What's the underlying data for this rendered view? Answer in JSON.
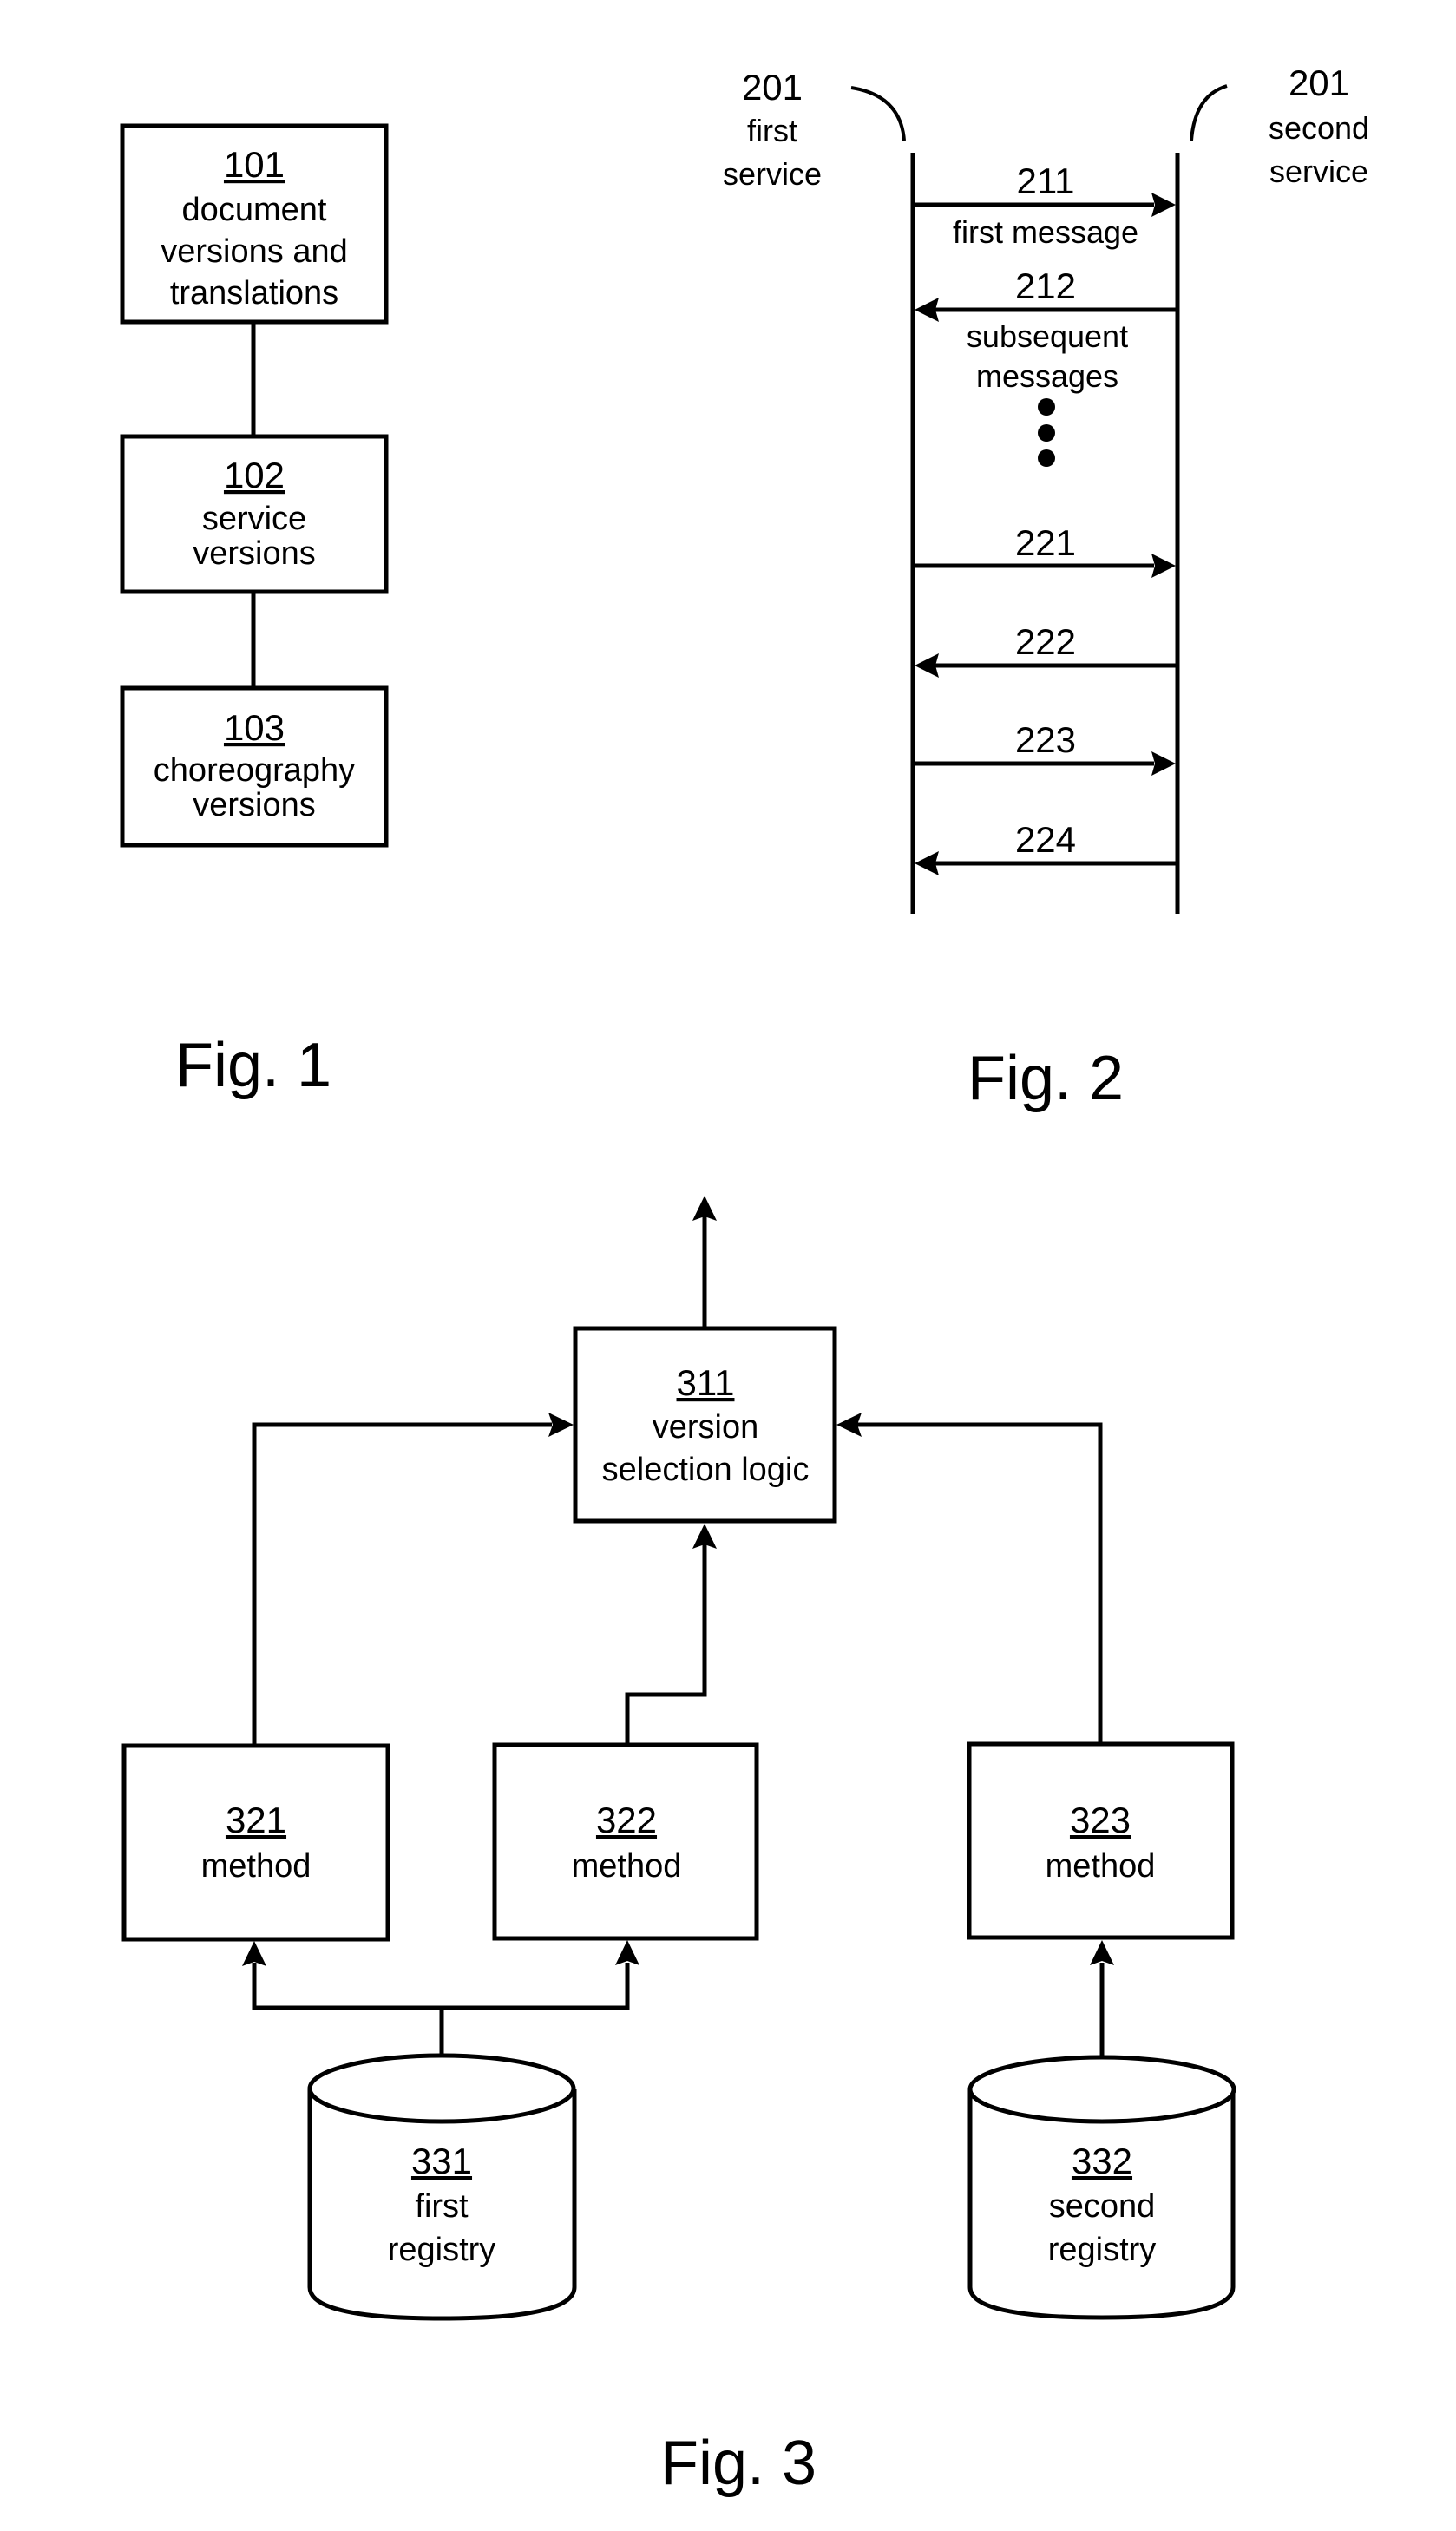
{
  "fig1": {
    "caption": "Fig. 1",
    "boxes": [
      {
        "number": "101",
        "lines": [
          "document",
          "versions and",
          "translations"
        ]
      },
      {
        "number": "102",
        "lines": [
          "service",
          "versions"
        ]
      },
      {
        "number": "103",
        "lines": [
          "choreography",
          "versions"
        ]
      }
    ]
  },
  "fig2": {
    "caption": "Fig. 2",
    "first_service": {
      "number": "201",
      "lines": [
        "first",
        "service"
      ]
    },
    "second_service": {
      "number": "201",
      "lines": [
        "second",
        "service"
      ]
    },
    "messages": [
      {
        "number": "211",
        "label": "first message",
        "direction": "right"
      },
      {
        "number": "212",
        "label": "subsequent messages",
        "label_lines": [
          "subsequent",
          "messages"
        ],
        "direction": "left"
      },
      {
        "number": "221",
        "direction": "right"
      },
      {
        "number": "222",
        "direction": "left"
      },
      {
        "number": "223",
        "direction": "right"
      },
      {
        "number": "224",
        "direction": "left"
      }
    ],
    "ellipsis": "vertical-dots"
  },
  "fig3": {
    "caption": "Fig. 3",
    "selector": {
      "number": "311",
      "lines": [
        "version",
        "selection logic"
      ]
    },
    "methods": [
      {
        "number": "321",
        "label": "method"
      },
      {
        "number": "322",
        "label": "method"
      },
      {
        "number": "323",
        "label": "method"
      }
    ],
    "registries": [
      {
        "number": "331",
        "lines": [
          "first",
          "registry"
        ]
      },
      {
        "number": "332",
        "lines": [
          "second",
          "registry"
        ]
      }
    ]
  }
}
